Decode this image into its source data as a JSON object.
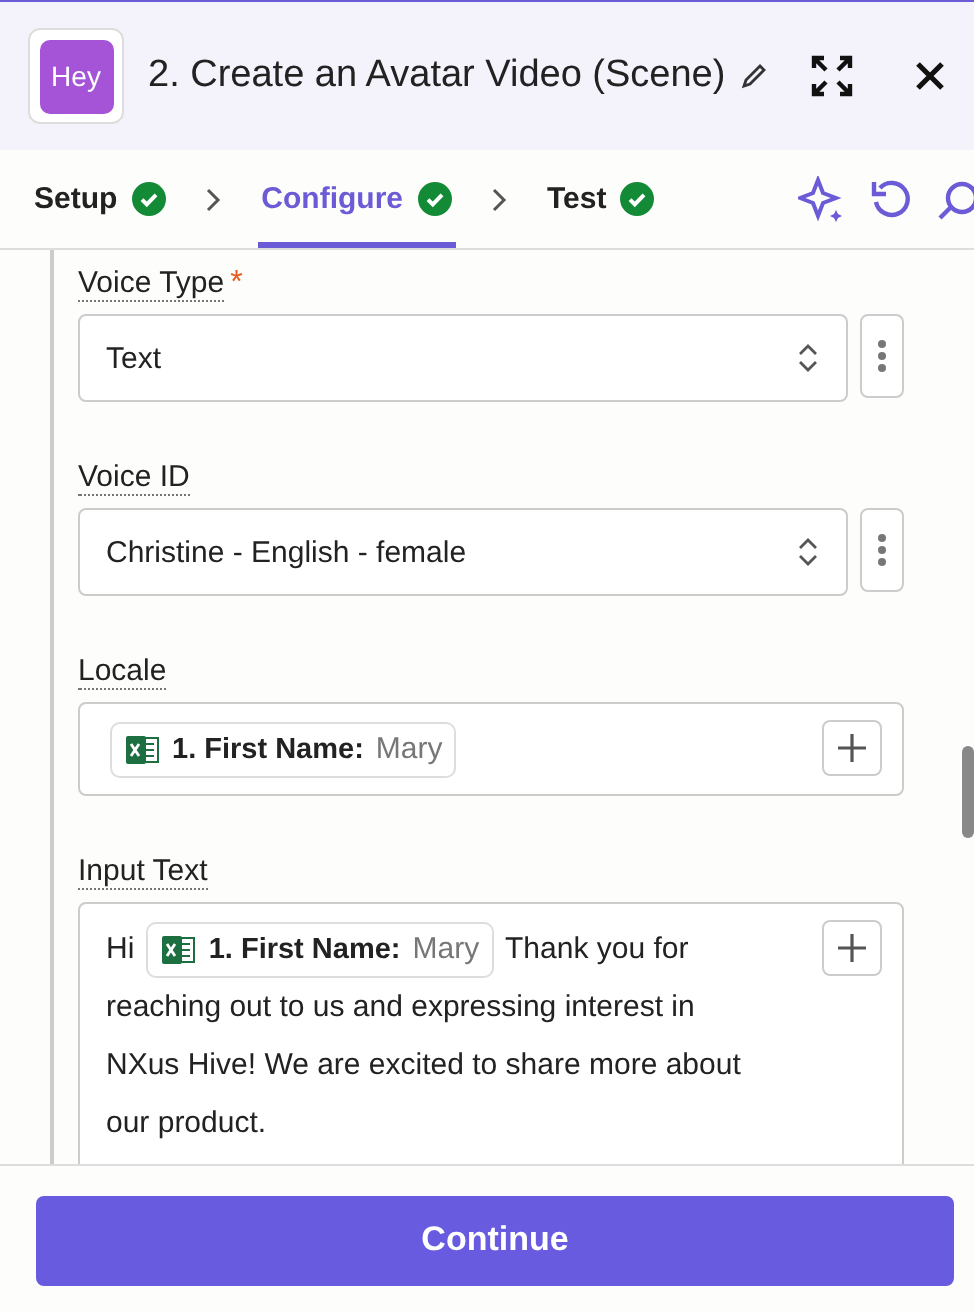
{
  "header": {
    "title": "2. Create an Avatar Video (Scene)",
    "app_logo_text": "Hey"
  },
  "steps": [
    {
      "label": "Setup",
      "complete": true,
      "selected": false
    },
    {
      "label": "Configure",
      "complete": true,
      "selected": true
    },
    {
      "label": "Test",
      "complete": true,
      "selected": false
    }
  ],
  "fields": [
    {
      "kind": "select",
      "label": "Voice Type",
      "required_mark": "*",
      "value": "Text"
    },
    {
      "kind": "select",
      "label": "Voice ID",
      "value": "Christine - English - female"
    },
    {
      "kind": "mapped",
      "label": "Locale",
      "segments": [
        {
          "kind": "chip",
          "label": "1. First Name:",
          "value": "Mary"
        }
      ]
    },
    {
      "kind": "mapped",
      "label": "Input Text",
      "segments": [
        {
          "kind": "text",
          "text": "Hi"
        },
        {
          "kind": "chip",
          "label": "1. First Name:",
          "value": "Mary"
        },
        {
          "kind": "text",
          "text": "Thank you for"
        },
        {
          "kind": "line",
          "text": "reaching out to us and expressing interest in"
        },
        {
          "kind": "line",
          "text": "NXus Hive! We are excited to share more about"
        },
        {
          "kind": "line",
          "text": "our product."
        }
      ]
    }
  ],
  "continue_button": "Continue"
}
